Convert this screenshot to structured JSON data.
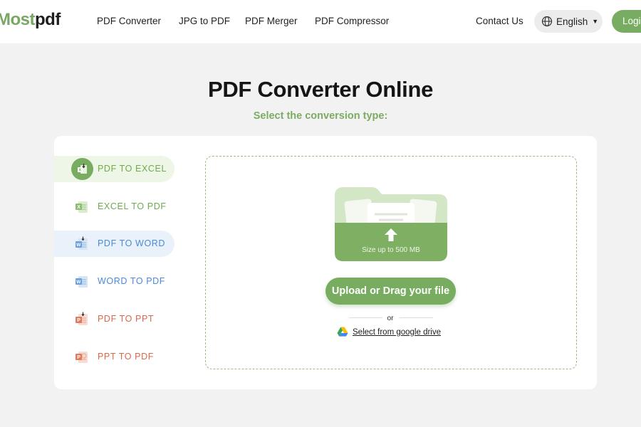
{
  "header": {
    "logo_part1": "Most",
    "logo_part2": "pdf",
    "nav": [
      "PDF Converter",
      "JPG to PDF",
      "PDF Merger",
      "PDF Compressor"
    ],
    "contact": "Contact Us",
    "language": "English",
    "login": "Login"
  },
  "hero": {
    "title": "PDF Converter Online",
    "subtitle": "Select the conversion type:"
  },
  "menu": [
    {
      "label": "PDF TO EXCEL",
      "icon": "excel-icon",
      "color": "#6eac4b",
      "active": true
    },
    {
      "label": "EXCEL TO PDF",
      "icon": "excel-icon",
      "color": "#6eac4b",
      "active": false
    },
    {
      "label": "PDF TO WORD",
      "icon": "word-icon",
      "color": "#4a8ad8",
      "active": true
    },
    {
      "label": "WORD TO PDF",
      "icon": "word-icon",
      "color": "#4a8ad8",
      "active": false
    },
    {
      "label": "PDF TO PPT",
      "icon": "ppt-icon",
      "color": "#d8684a",
      "active": false
    },
    {
      "label": "PPT TO PDF",
      "icon": "ppt-icon",
      "color": "#d8684a",
      "active": false
    }
  ],
  "upload": {
    "size_limit": "Size up to 500 MB",
    "button": "Upload or Drag your file",
    "or": "or",
    "gdrive": "Select from google drive"
  },
  "colors": {
    "accent": "#78ac61",
    "page_bg": "#f2f2f2"
  }
}
